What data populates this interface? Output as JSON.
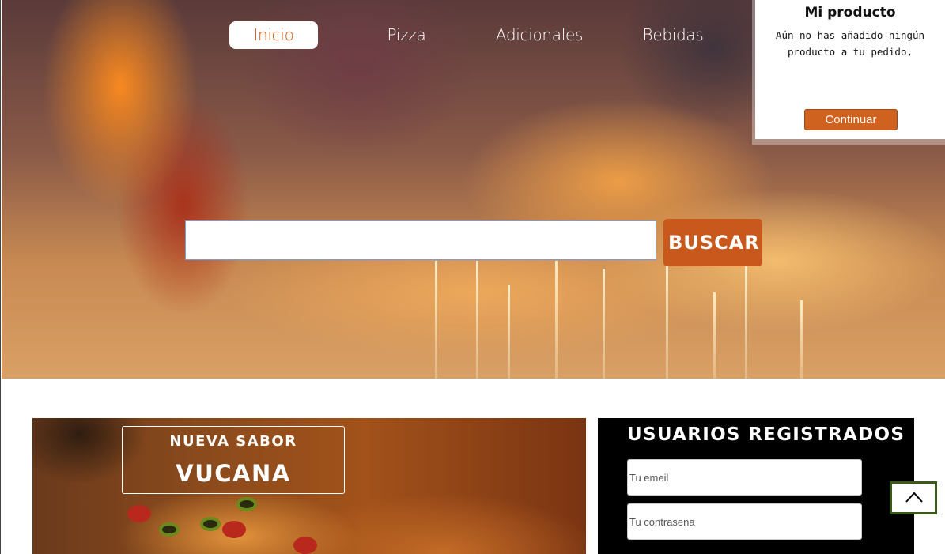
{
  "nav": {
    "items": [
      {
        "label": "Inicio",
        "active": true
      },
      {
        "label": "Pizza",
        "active": false
      },
      {
        "label": "Adicionales",
        "active": false
      },
      {
        "label": "Bebidas",
        "active": false
      }
    ]
  },
  "search": {
    "value": "",
    "button_label": "BUSCAR"
  },
  "cart": {
    "title": "Mi producto",
    "message": "Aún no has añadido ningún producto a tu pedido,",
    "button_label": "Continuar"
  },
  "promo": {
    "small_text": "NUEVA SABOR",
    "big_text": "VUCANA"
  },
  "login": {
    "title": "USUARIOS REGISTRADOS",
    "email_placeholder": "Tu emeil",
    "password_placeholder": "Tu contrasena"
  },
  "scroll_top": {
    "icon": "chevron-up-icon"
  },
  "colors": {
    "accent": "#c9581c",
    "cart_button": "#d0621f",
    "scroll_top_border": "#3a5a1c"
  }
}
